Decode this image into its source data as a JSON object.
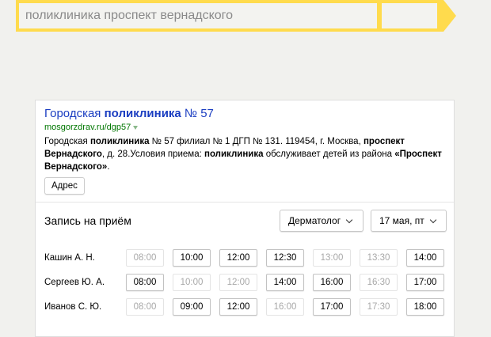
{
  "search": {
    "query": "поликлиника проспект вернадского"
  },
  "result": {
    "title_prefix": "Городская ",
    "title_bold": "поликлиника",
    "title_suffix": " № 57",
    "url": "mosgorzdrav.ru/dgp57",
    "text_parts": [
      {
        "t": "Городская ",
        "b": false
      },
      {
        "t": "поликлиника",
        "b": true
      },
      {
        "t": " № 57 филиал № 1 ДГП № 131. 119454, г. Москва, ",
        "b": false
      },
      {
        "t": "проспект Вернадского",
        "b": true
      },
      {
        "t": ", д. 28.Условия приема: ",
        "b": false
      },
      {
        "t": "поликлиника",
        "b": true
      },
      {
        "t": " обслуживает детей из района ",
        "b": false
      },
      {
        "t": "«Проспект Вернадского»",
        "b": true
      },
      {
        "t": ".",
        "b": false
      }
    ],
    "address_button": "Адрес"
  },
  "booking": {
    "title": "Запись на приём",
    "specialty": "Дерматолог",
    "date": "17 мая, пт",
    "doctors": [
      {
        "name": "Кашин А. Н.",
        "slots": [
          {
            "time": "08:00",
            "free": false
          },
          {
            "time": "10:00",
            "free": true
          },
          {
            "time": "12:00",
            "free": true
          },
          {
            "time": "12:30",
            "free": true
          },
          {
            "time": "13:00",
            "free": false
          },
          {
            "time": "13:30",
            "free": false
          },
          {
            "time": "14:00",
            "free": true
          }
        ]
      },
      {
        "name": "Сергеев Ю. А.",
        "slots": [
          {
            "time": "08:00",
            "free": true
          },
          {
            "time": "10:00",
            "free": false
          },
          {
            "time": "12:00",
            "free": false
          },
          {
            "time": "14:00",
            "free": true
          },
          {
            "time": "16:00",
            "free": true
          },
          {
            "time": "16:30",
            "free": false
          },
          {
            "time": "17:00",
            "free": true
          }
        ]
      },
      {
        "name": "Иванов С. Ю.",
        "slots": [
          {
            "time": "08:00",
            "free": false
          },
          {
            "time": "09:00",
            "free": true
          },
          {
            "time": "12:00",
            "free": true
          },
          {
            "time": "16:00",
            "free": false
          },
          {
            "time": "17:00",
            "free": true
          },
          {
            "time": "17:30",
            "free": false
          },
          {
            "time": "18:00",
            "free": true
          }
        ]
      }
    ]
  },
  "colors": {
    "accent": "#ffdb4d",
    "link": "#1a3dc1",
    "url": "#007700"
  }
}
